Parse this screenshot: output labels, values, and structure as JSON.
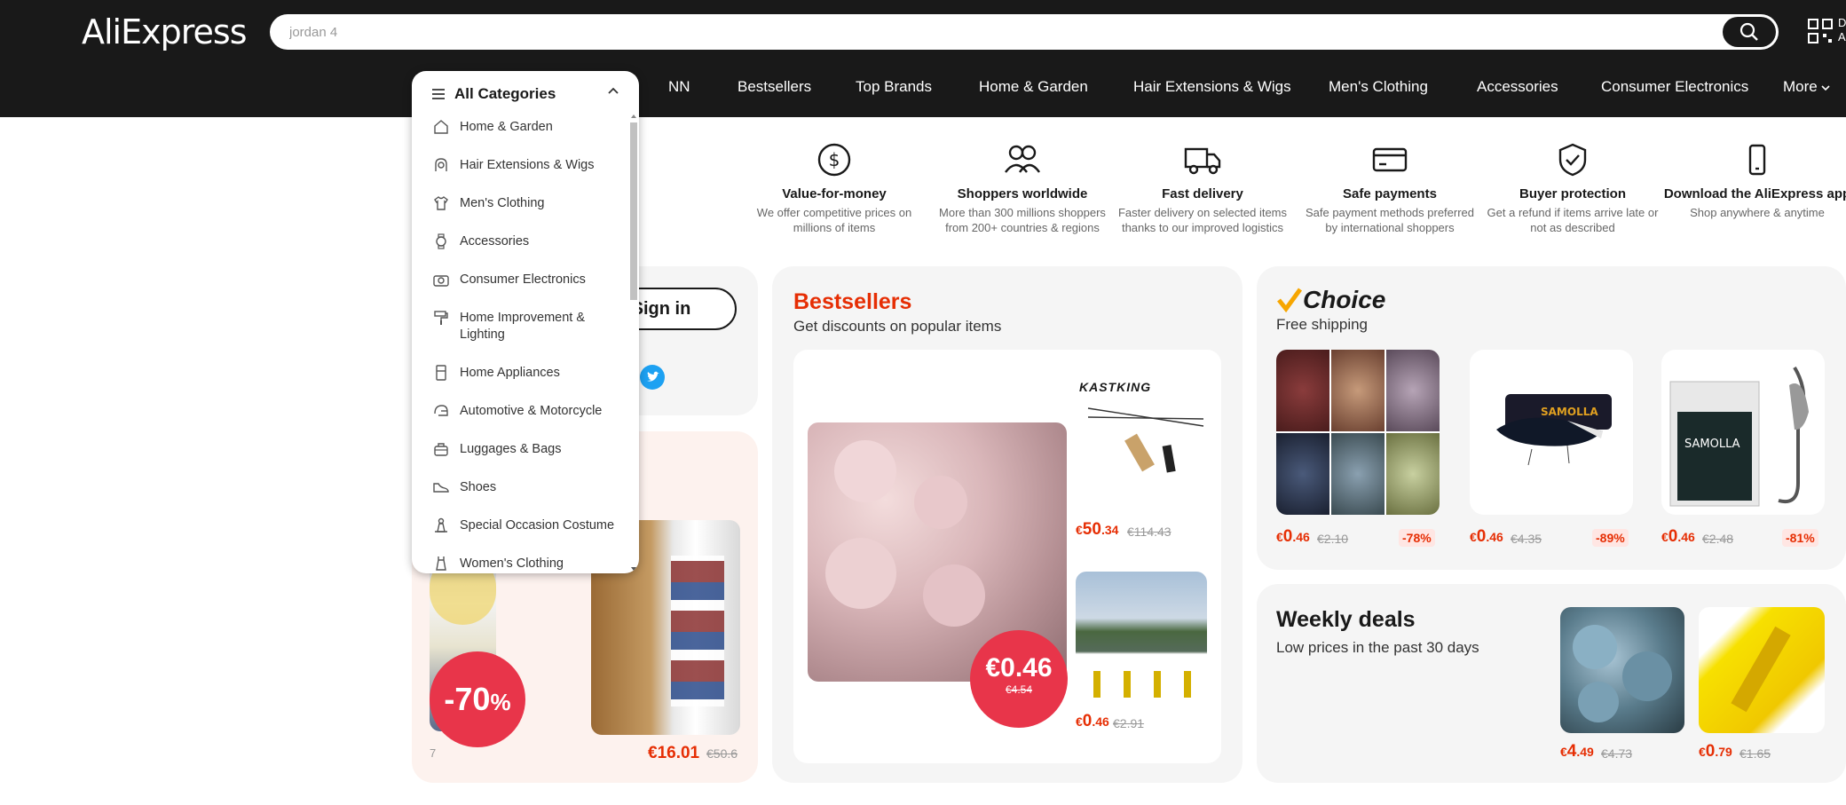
{
  "header": {
    "logo": "AliExpress",
    "search_value": "jordan 4",
    "qr_text": "D A"
  },
  "nav": {
    "items": [
      "NN",
      "Bestsellers",
      "Top Brands",
      "Home & Garden",
      "Hair Extensions & Wigs",
      "Men's Clothing",
      "Accessories",
      "Consumer Electronics",
      "More"
    ]
  },
  "categories": {
    "title": "All Categories",
    "items": [
      {
        "label": "Home & Garden",
        "icon": "house-icon"
      },
      {
        "label": "Hair Extensions & Wigs",
        "icon": "wig-icon"
      },
      {
        "label": "Men's Clothing",
        "icon": "shirt-icon"
      },
      {
        "label": "Accessories",
        "icon": "watch-icon"
      },
      {
        "label": "Consumer Electronics",
        "icon": "camera-icon"
      },
      {
        "label": "Home Improvement & Lighting",
        "icon": "paint-roller-icon"
      },
      {
        "label": "Home Appliances",
        "icon": "fridge-icon"
      },
      {
        "label": "Automotive & Motorcycle",
        "icon": "helmet-icon"
      },
      {
        "label": "Luggages & Bags",
        "icon": "bag-icon"
      },
      {
        "label": "Shoes",
        "icon": "shoe-icon"
      },
      {
        "label": "Special Occasion Costume",
        "icon": "costume-icon"
      },
      {
        "label": "Women's Clothing",
        "icon": "dress-icon"
      }
    ]
  },
  "features": [
    {
      "title": "Value-for-money",
      "desc": "We offer competitive prices on millions of items",
      "icon": "dollar-icon"
    },
    {
      "title": "Shoppers worldwide",
      "desc": "More than 300 millions shoppers from 200+ countries & regions",
      "icon": "people-icon"
    },
    {
      "title": "Fast delivery",
      "desc": "Faster delivery on selected items thanks to our improved logistics",
      "icon": "truck-icon"
    },
    {
      "title": "Safe payments",
      "desc": "Safe payment methods preferred by international shoppers",
      "icon": "card-icon"
    },
    {
      "title": "Buyer protection",
      "desc": "Get a refund if items arrive late or not as described",
      "icon": "shield-check-icon"
    },
    {
      "title": "Download the AliExpress app",
      "desc": "Shop anywhere & anytime",
      "icon": "phone-icon"
    }
  ],
  "login": {
    "signin_label": "Sign in"
  },
  "promo": {
    "discount": "-70",
    "discount_unit": "%",
    "left_partial_price": "7",
    "price": "€16.01",
    "old_price": "€50.6"
  },
  "bestsellers": {
    "title": "Bestsellers",
    "subtitle": "Get discounts on popular items",
    "main_price": "€0.46",
    "main_old": "€4.54",
    "brand": "KASTKING",
    "item1": {
      "currency": "€",
      "int": "50",
      "dec": ".34",
      "old": "€114.43"
    },
    "item2": {
      "currency": "€",
      "int": "0",
      "dec": ".46",
      "old": "€2.91"
    }
  },
  "choice": {
    "title": "Choice",
    "subtitle": "Free shipping",
    "products": [
      {
        "currency": "€",
        "int": "0",
        "dec": ".46",
        "old": "€2.10",
        "discount": "-78%"
      },
      {
        "currency": "€",
        "int": "0",
        "dec": ".46",
        "old": "€4.35",
        "discount": "-89%"
      },
      {
        "currency": "€",
        "int": "0",
        "dec": ".46",
        "old": "€2.48",
        "discount": "-81%"
      }
    ]
  },
  "weekly": {
    "title": "Weekly deals",
    "subtitle": "Low prices in the past 30 days",
    "products": [
      {
        "currency": "€",
        "int": "4",
        "dec": ".49",
        "old": "€4.73"
      },
      {
        "currency": "€",
        "int": "0",
        "dec": ".79",
        "old": "€1.65"
      }
    ]
  }
}
